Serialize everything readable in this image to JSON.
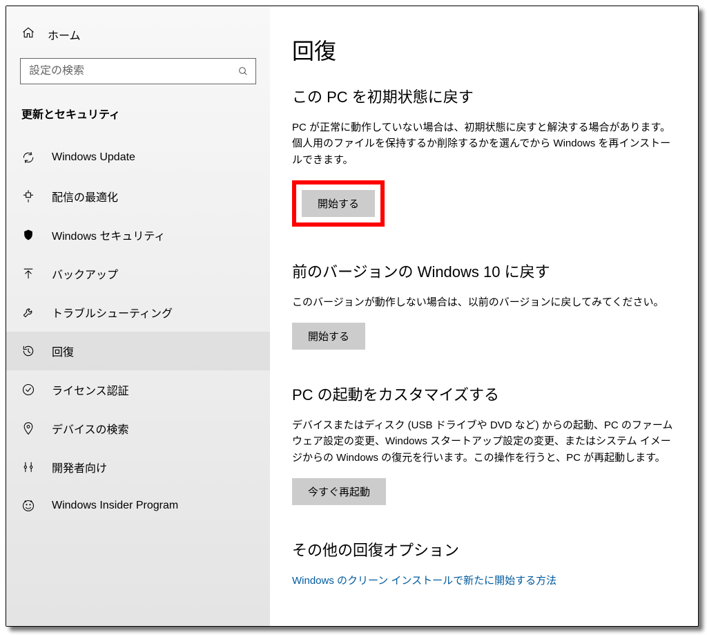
{
  "sidebar": {
    "home_label": "ホーム",
    "search_placeholder": "設定の検索",
    "category_heading": "更新とセキュリティ",
    "items": [
      {
        "id": "windows-update",
        "label": "Windows Update"
      },
      {
        "id": "delivery-optimization",
        "label": "配信の最適化"
      },
      {
        "id": "windows-security",
        "label": "Windows セキュリティ"
      },
      {
        "id": "backup",
        "label": "バックアップ"
      },
      {
        "id": "troubleshoot",
        "label": "トラブルシューティング"
      },
      {
        "id": "recovery",
        "label": "回復"
      },
      {
        "id": "activation",
        "label": "ライセンス認証"
      },
      {
        "id": "find-my-device",
        "label": "デバイスの検索"
      },
      {
        "id": "for-developers",
        "label": "開発者向け"
      },
      {
        "id": "windows-insider-program",
        "label": "Windows Insider Program"
      }
    ]
  },
  "main": {
    "page_title": "回復",
    "reset": {
      "title": "この PC を初期状態に戻す",
      "desc": "PC が正常に動作していない場合は、初期状態に戻すと解決する場合があります。個人用のファイルを保持するか削除するかを選んでから Windows を再インストールできます。",
      "button": "開始する"
    },
    "goback": {
      "title": "前のバージョンの Windows 10 に戻す",
      "desc": "このバージョンが動作しない場合は、以前のバージョンに戻してみてください。",
      "button": "開始する"
    },
    "advanced": {
      "title": "PC の起動をカスタマイズする",
      "desc": "デバイスまたはディスク (USB ドライブや DVD など) からの起動、PC のファームウェア設定の変更、Windows スタートアップ設定の変更、またはシステム イメージからの Windows の復元を行います。この操作を行うと、PC が再起動します。",
      "button": "今すぐ再起動"
    },
    "more": {
      "title": "その他の回復オプション",
      "link": "Windows のクリーン インストールで新たに開始する方法"
    }
  }
}
